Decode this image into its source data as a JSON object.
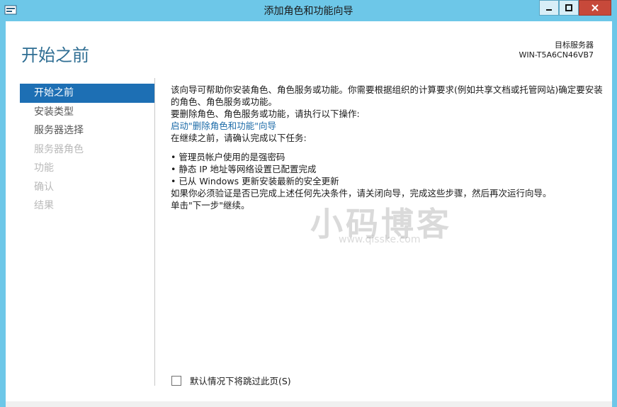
{
  "window": {
    "title": "添加角色和功能向导"
  },
  "header": {
    "page_title": "开始之前",
    "target_label": "目标服务器",
    "target_server": "WIN-T5A6CN46VB7"
  },
  "nav": {
    "items": [
      {
        "label": "开始之前",
        "state": "active"
      },
      {
        "label": "安装类型",
        "state": "enabled"
      },
      {
        "label": "服务器选择",
        "state": "enabled"
      },
      {
        "label": "服务器角色",
        "state": "disabled"
      },
      {
        "label": "功能",
        "state": "disabled"
      },
      {
        "label": "确认",
        "state": "disabled"
      },
      {
        "label": "结果",
        "state": "disabled"
      }
    ]
  },
  "content": {
    "intro": "该向导可帮助你安装角色、角色服务或功能。你需要根据组织的计算要求(例如共享文档或托管网站)确定要安装的角色、角色服务或功能。",
    "remove_text": "要删除角色、角色服务或功能，请执行以下操作:",
    "remove_link": "启动\"删除角色和功能\"向导",
    "before_continue": "在继续之前，请确认完成以下任务:",
    "tasks": [
      "管理员帐户使用的是强密码",
      "静态 IP 地址等网络设置已配置完成",
      "已从 Windows 更新安装最新的安全更新"
    ],
    "verify_text": "如果你必须验证是否已完成上述任何先决条件，请关闭向导，完成这些步骤，然后再次运行向导。",
    "continue_text": "单击\"下一步\"继续。"
  },
  "footer": {
    "skip_checkbox_label": "默认情况下将跳过此页(S)",
    "skip_checked": false
  },
  "watermark": {
    "text": "小码博客",
    "url": "www.qisske.com"
  },
  "colors": {
    "titlebar": "#6dc7e8",
    "accent": "#1d6fb4",
    "heading": "#2f6e93",
    "link": "#1c6ba8"
  }
}
